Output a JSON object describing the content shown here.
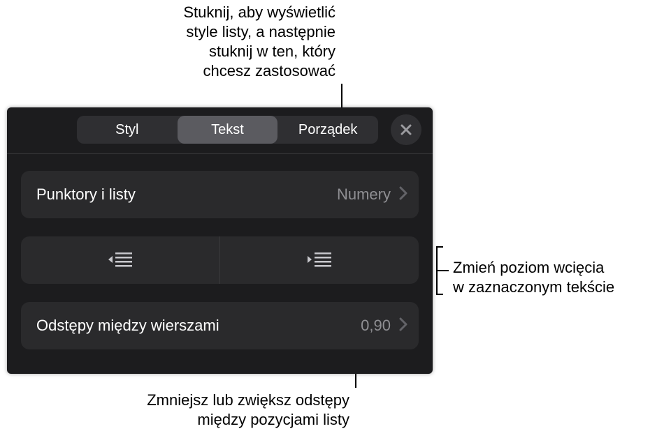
{
  "callouts": {
    "top": "Stuknij, aby wyświetlić\nstyle listy, a następnie\nstuknij w ten, który\nchcesz zastosować",
    "right": "Zmień poziom wcięcia\nw zaznaczonym tekście",
    "bottom": "Zmniejsz lub zwiększ odstępy\nmiędzy pozycjami listy"
  },
  "tabs": {
    "style": "Styl",
    "text": "Tekst",
    "arrange": "Porządek"
  },
  "rows": {
    "bullets": {
      "label": "Punktory i listy",
      "value": "Numery"
    },
    "spacing": {
      "label": "Odstępy między wierszami",
      "value": "0,90"
    }
  }
}
